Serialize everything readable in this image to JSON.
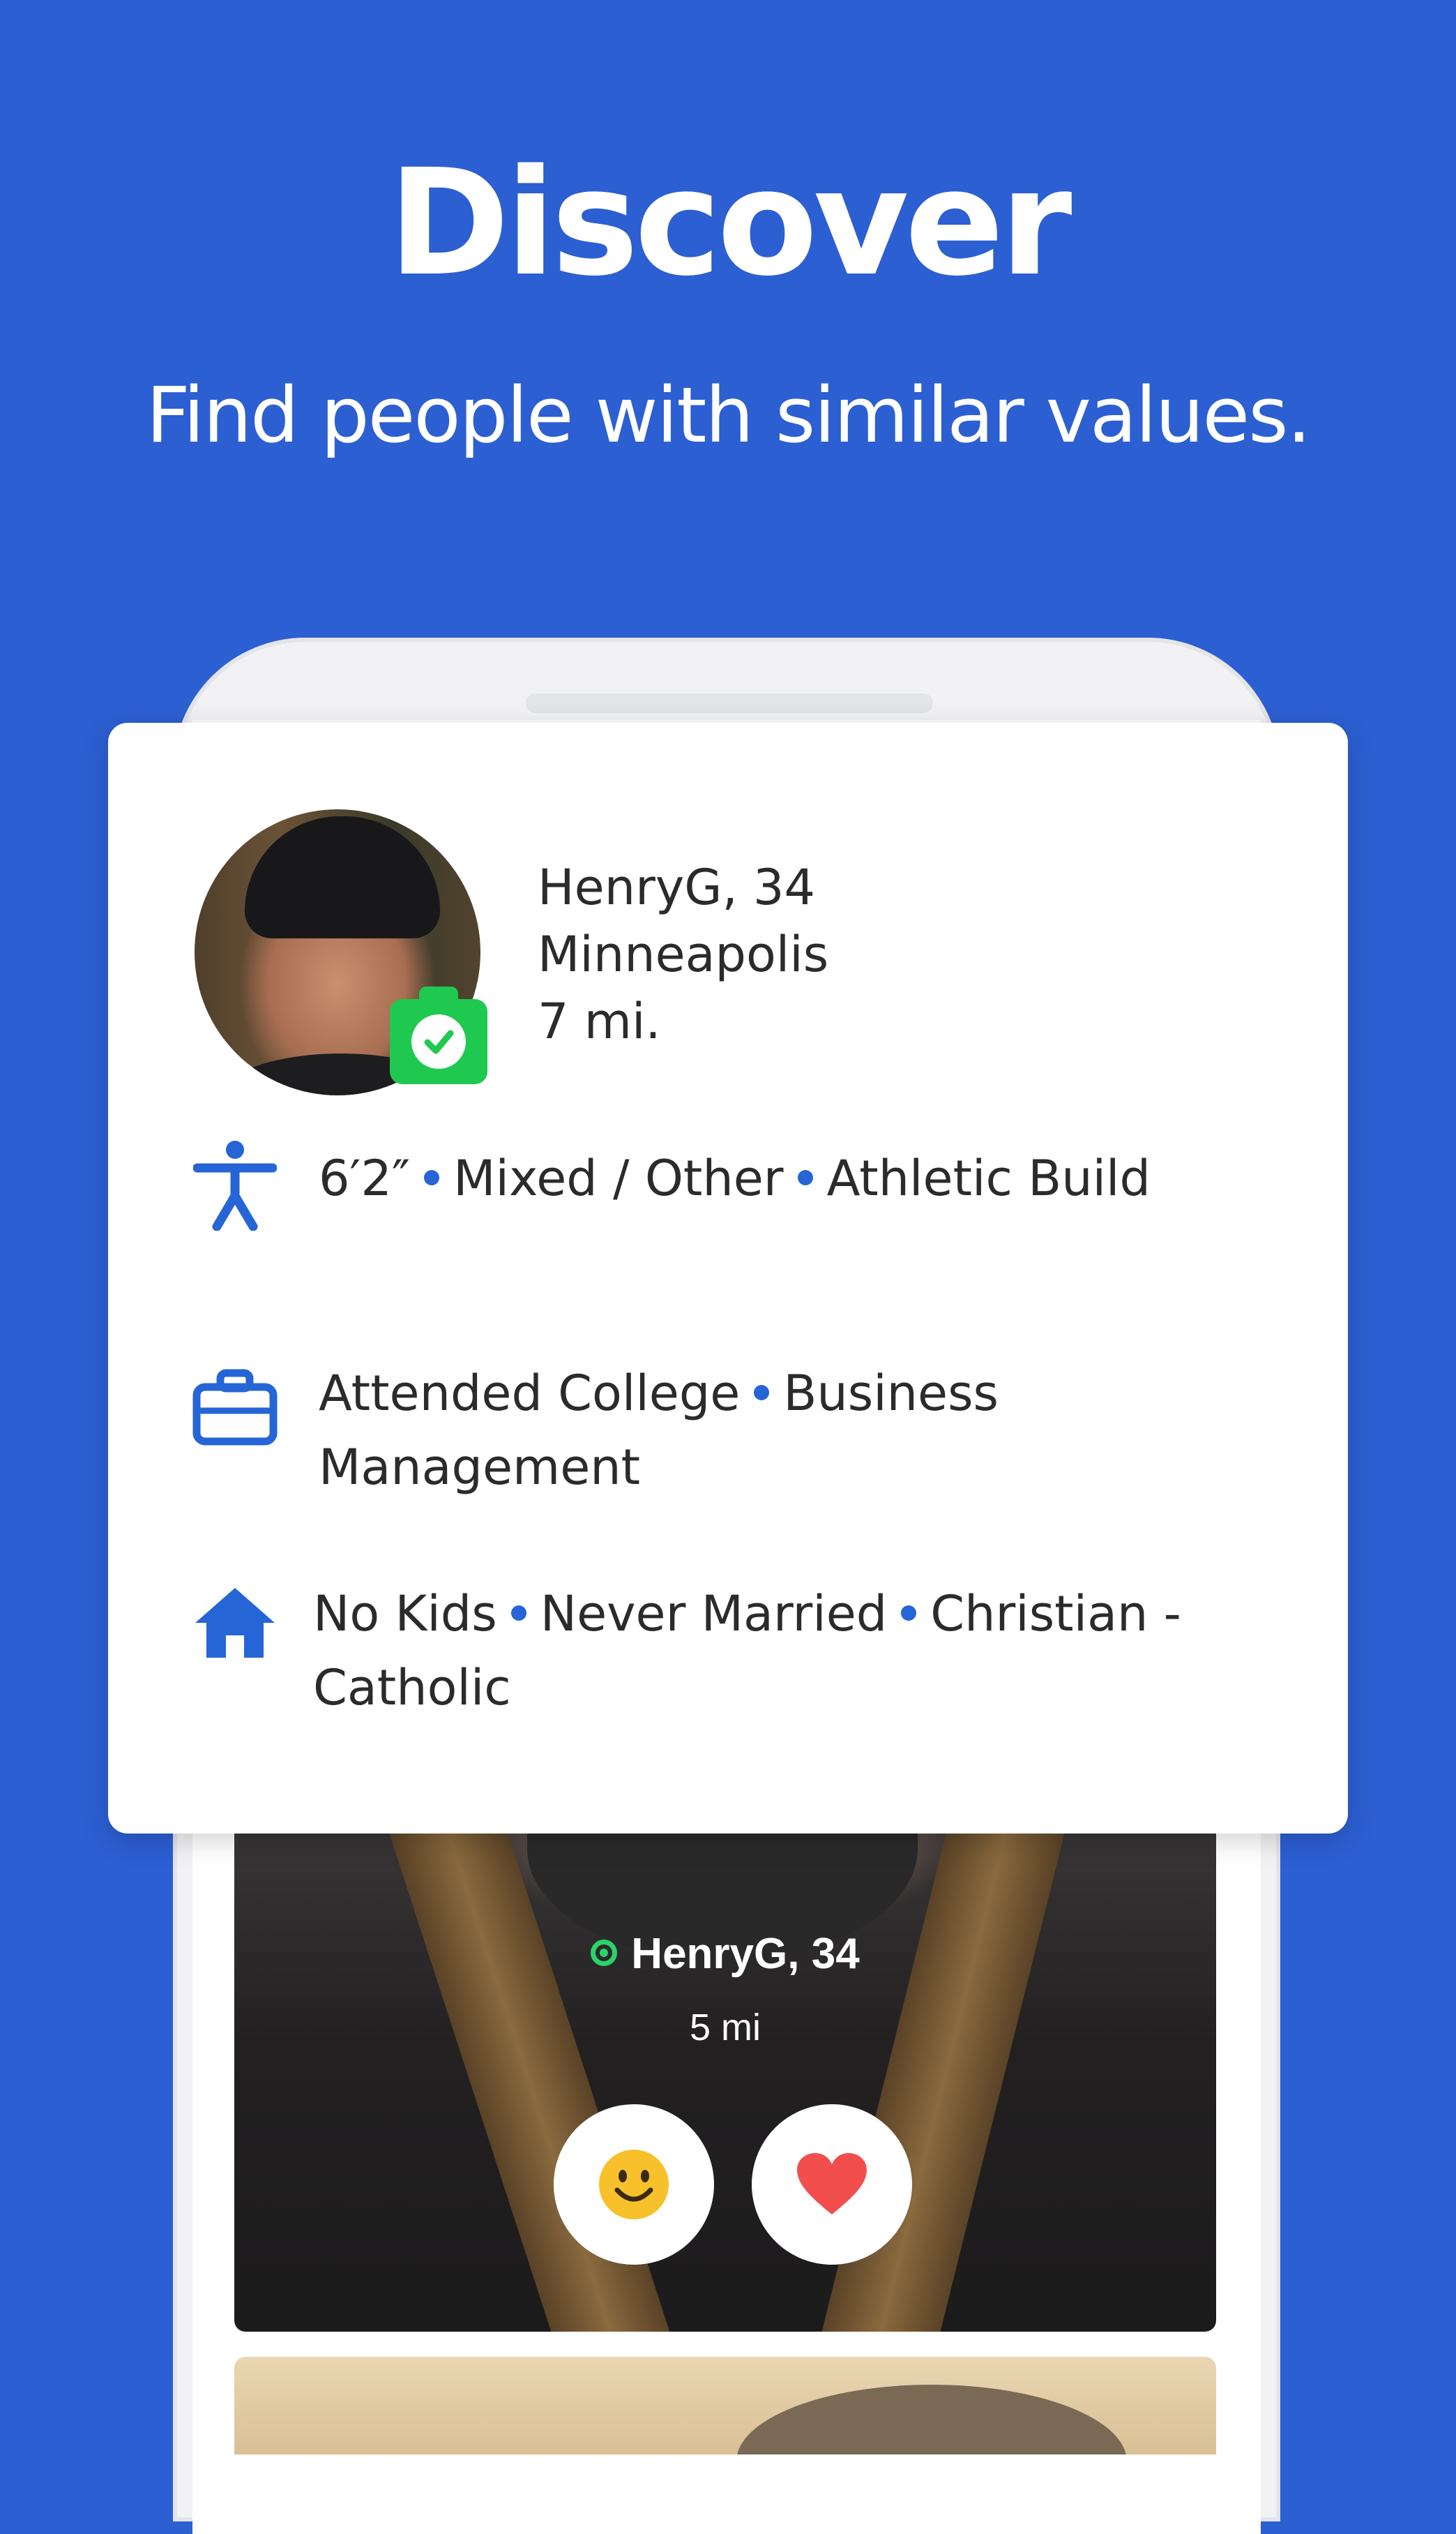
{
  "header": {
    "title": "Discover",
    "subtitle": "Find people with similar values."
  },
  "profile": {
    "name_age": "HenryG, 34",
    "city": "Minneapolis",
    "distance": "7 mi.",
    "verified_badge": "photo-verified-camera-icon",
    "details": {
      "physical": [
        "6′2″",
        "Mixed / Other",
        "Athletic Build"
      ],
      "work": [
        "Attended College",
        "Business",
        "Management"
      ],
      "family": [
        "No Kids",
        "Never Married",
        "Christian -",
        "Catholic"
      ]
    }
  },
  "photo_card": {
    "name_age": "HenryG, 34",
    "distance": "5 mi",
    "online_indicator": "online-dot",
    "actions": [
      {
        "name": "smile-button",
        "icon": "smiley-icon"
      },
      {
        "name": "like-button",
        "icon": "heart-icon"
      }
    ]
  },
  "colors": {
    "background": "#2c5fd2",
    "accent_blue": "#2565d6",
    "verified_green": "#1fc94f",
    "online_green": "#2bd36b",
    "heart_red": "#f24e4e",
    "smiley_yellow": "#f6c12a"
  }
}
